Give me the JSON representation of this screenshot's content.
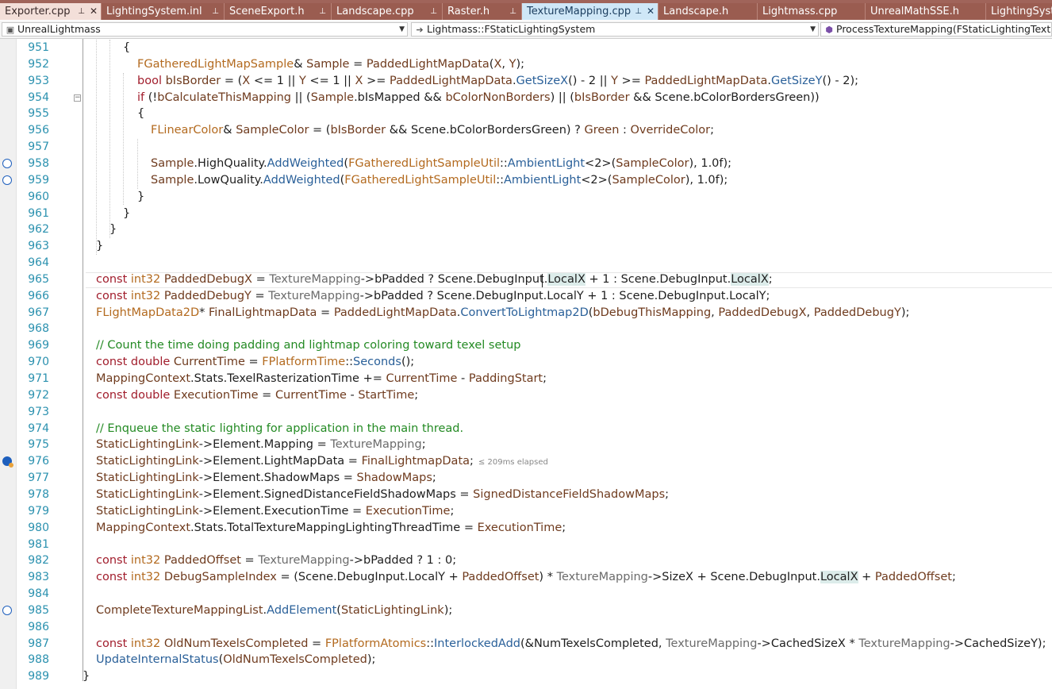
{
  "tabs": [
    {
      "label": "Exporter.cpp",
      "state": "first",
      "pin": "⊥",
      "close": "✕"
    },
    {
      "label": "LightingSystem.inl",
      "state": "normal",
      "pin": "⊥"
    },
    {
      "label": "SceneExport.h",
      "state": "normal",
      "pin": "⊥"
    },
    {
      "label": "Landscape.cpp",
      "state": "normal",
      "pin": "⊥"
    },
    {
      "label": "Raster.h",
      "state": "normal",
      "pin": "⊥"
    },
    {
      "label": "TextureMapping.cpp",
      "state": "active",
      "pin": "⊥",
      "close": "✕"
    },
    {
      "label": "Landscape.h",
      "state": "normal"
    },
    {
      "label": "Lightmass.cpp",
      "state": "normal"
    },
    {
      "label": "UnrealMathSSE.h",
      "state": "normal"
    },
    {
      "label": "LightingSyste",
      "state": "normal"
    }
  ],
  "navbar": {
    "project": "UnrealLightmass",
    "scope": "Lightmass::FStaticLightingSystem",
    "member": "ProcessTextureMapping(FStaticLightingTexture"
  },
  "editor": {
    "inline_hint": "≤ 209ms elapsed",
    "lines": [
      {
        "n": "951",
        "indent": 155,
        "tokens": [
          [
            "{",
            ""
          ]
        ]
      },
      {
        "n": "952",
        "indent": 173,
        "tokens": [
          [
            "FGatheredLightMapSample",
            "t"
          ],
          [
            "& ",
            ""
          ],
          [
            "Sample",
            "vm"
          ],
          [
            " = ",
            ""
          ],
          [
            "PaddedLightMapData",
            "vm"
          ],
          [
            "(",
            ""
          ],
          [
            "X",
            "vm"
          ],
          [
            ", ",
            ""
          ],
          [
            "Y",
            "vm"
          ],
          [
            ");",
            ""
          ]
        ]
      },
      {
        "n": "953",
        "indent": 173,
        "tokens": [
          [
            "bool ",
            "kw"
          ],
          [
            "bIsBorder",
            "vm"
          ],
          [
            " = (",
            ""
          ],
          [
            "X",
            "vm"
          ],
          [
            " <= 1 || ",
            ""
          ],
          [
            "Y",
            "vm"
          ],
          [
            " <= 1 || ",
            ""
          ],
          [
            "X",
            "vm"
          ],
          [
            " >= ",
            ""
          ],
          [
            "PaddedLightMapData",
            "vm"
          ],
          [
            ".",
            ""
          ],
          [
            "GetSizeX",
            "fn"
          ],
          [
            "() - 2 || ",
            ""
          ],
          [
            "Y",
            "vm"
          ],
          [
            " >= ",
            ""
          ],
          [
            "PaddedLightMapData",
            "vm"
          ],
          [
            ".",
            ""
          ],
          [
            "GetSizeY",
            "fn"
          ],
          [
            "() - 2);",
            ""
          ]
        ]
      },
      {
        "n": "954",
        "indent": 173,
        "tokens": [
          [
            "if",
            "kw"
          ],
          [
            " (!",
            ""
          ],
          [
            "bCalculateThisMapping",
            "vm"
          ],
          [
            " || (",
            ""
          ],
          [
            "Sample",
            "vm"
          ],
          [
            ".bIsMapped && ",
            ""
          ],
          [
            "bColorNonBorders",
            "vm"
          ],
          [
            ") || (",
            ""
          ],
          [
            "bIsBorder",
            "vm"
          ],
          [
            " && Scene.bColorBordersGreen))",
            ""
          ]
        ]
      },
      {
        "n": "955",
        "indent": 173,
        "tokens": [
          [
            "{",
            ""
          ]
        ]
      },
      {
        "n": "956",
        "indent": 190,
        "tokens": [
          [
            "FLinearColor",
            "t"
          ],
          [
            "& ",
            ""
          ],
          [
            "SampleColor",
            "vm"
          ],
          [
            " = (",
            ""
          ],
          [
            "bIsBorder",
            "vm"
          ],
          [
            " && Scene.bColorBordersGreen) ? ",
            ""
          ],
          [
            "Green",
            "vm"
          ],
          [
            " : ",
            ""
          ],
          [
            "OverrideColor",
            "vm"
          ],
          [
            ";",
            ""
          ]
        ]
      },
      {
        "n": "957",
        "indent": 190,
        "tokens": []
      },
      {
        "n": "958",
        "indent": 190,
        "tokens": [
          [
            "Sample",
            "vm"
          ],
          [
            ".HighQuality.",
            ""
          ],
          [
            "AddWeighted",
            "fn"
          ],
          [
            "(",
            ""
          ],
          [
            "FGatheredLightSampleUtil",
            "t"
          ],
          [
            "::",
            ""
          ],
          [
            "AmbientLight",
            "fn"
          ],
          [
            "<2>(",
            ""
          ],
          [
            "SampleColor",
            "vm"
          ],
          [
            "), 1.0f);",
            ""
          ]
        ]
      },
      {
        "n": "959",
        "indent": 190,
        "tokens": [
          [
            "Sample",
            "vm"
          ],
          [
            ".LowQuality.",
            ""
          ],
          [
            "AddWeighted",
            "fn"
          ],
          [
            "(",
            ""
          ],
          [
            "FGatheredLightSampleUtil",
            "t"
          ],
          [
            "::",
            ""
          ],
          [
            "AmbientLight",
            "fn"
          ],
          [
            "<2>(",
            ""
          ],
          [
            "SampleColor",
            "vm"
          ],
          [
            "), 1.0f);",
            ""
          ]
        ]
      },
      {
        "n": "960",
        "indent": 173,
        "tokens": [
          [
            "}",
            ""
          ]
        ]
      },
      {
        "n": "961",
        "indent": 155,
        "tokens": [
          [
            "}",
            ""
          ]
        ]
      },
      {
        "n": "962",
        "indent": 138,
        "tokens": [
          [
            "}",
            ""
          ]
        ]
      },
      {
        "n": "963",
        "indent": 121,
        "tokens": [
          [
            "}",
            ""
          ]
        ]
      },
      {
        "n": "964",
        "indent": 121,
        "tokens": []
      },
      {
        "n": "965",
        "indent": 121,
        "tokens": [
          [
            "const ",
            "kw"
          ],
          [
            "int32 ",
            "t"
          ],
          [
            "PaddedDebugX",
            "vm"
          ],
          [
            " = ",
            ""
          ],
          [
            "TextureMapping",
            "pr"
          ],
          [
            "->bPadded ? Scene.DebugInput.",
            ""
          ],
          [
            "LocalX",
            "hl"
          ],
          [
            " + 1 : Scene.DebugInput.",
            ""
          ],
          [
            "LocalX",
            "hl"
          ],
          [
            ";",
            ""
          ]
        ]
      },
      {
        "n": "966",
        "indent": 121,
        "tokens": [
          [
            "const ",
            "kw"
          ],
          [
            "int32 ",
            "t"
          ],
          [
            "PaddedDebugY",
            "vm"
          ],
          [
            " = ",
            ""
          ],
          [
            "TextureMapping",
            "pr"
          ],
          [
            "->bPadded ? Scene.DebugInput.LocalY + 1 : Scene.DebugInput.LocalY;",
            ""
          ]
        ]
      },
      {
        "n": "967",
        "indent": 121,
        "tokens": [
          [
            "FLightMapData2D",
            "t"
          ],
          [
            "* ",
            ""
          ],
          [
            "FinalLightmapData",
            "vm"
          ],
          [
            " = ",
            ""
          ],
          [
            "PaddedLightMapData",
            "vm"
          ],
          [
            ".",
            ""
          ],
          [
            "ConvertToLightmap2D",
            "fn"
          ],
          [
            "(",
            ""
          ],
          [
            "bDebugThisMapping",
            "vm"
          ],
          [
            ", ",
            ""
          ],
          [
            "PaddedDebugX",
            "vm"
          ],
          [
            ", ",
            ""
          ],
          [
            "PaddedDebugY",
            "vm"
          ],
          [
            ");",
            ""
          ]
        ]
      },
      {
        "n": "968",
        "indent": 121,
        "tokens": []
      },
      {
        "n": "969",
        "indent": 121,
        "tokens": [
          [
            "// Count the time doing padding and lightmap coloring toward texel setup",
            "cm"
          ]
        ]
      },
      {
        "n": "970",
        "indent": 121,
        "tokens": [
          [
            "const ",
            "kw"
          ],
          [
            "double ",
            "kw"
          ],
          [
            "CurrentTime",
            "vm"
          ],
          [
            " = ",
            ""
          ],
          [
            "FPlatformTime",
            "t"
          ],
          [
            "::",
            ""
          ],
          [
            "Seconds",
            "fn"
          ],
          [
            "();",
            ""
          ]
        ]
      },
      {
        "n": "971",
        "indent": 121,
        "tokens": [
          [
            "MappingContext",
            "vm"
          ],
          [
            ".Stats.TexelRasterizationTime += ",
            ""
          ],
          [
            "CurrentTime",
            "vm"
          ],
          [
            " - ",
            ""
          ],
          [
            "PaddingStart",
            "vm"
          ],
          [
            ";",
            ""
          ]
        ]
      },
      {
        "n": "972",
        "indent": 121,
        "tokens": [
          [
            "const ",
            "kw"
          ],
          [
            "double ",
            "kw"
          ],
          [
            "ExecutionTime",
            "vm"
          ],
          [
            " = ",
            ""
          ],
          [
            "CurrentTime",
            "vm"
          ],
          [
            " - ",
            ""
          ],
          [
            "StartTime",
            "vm"
          ],
          [
            ";",
            ""
          ]
        ]
      },
      {
        "n": "973",
        "indent": 121,
        "tokens": []
      },
      {
        "n": "974",
        "indent": 121,
        "tokens": [
          [
            "// Enqueue the static lighting for application in the main thread.",
            "cm"
          ]
        ]
      },
      {
        "n": "975",
        "indent": 121,
        "tokens": [
          [
            "StaticLightingLink",
            "vm"
          ],
          [
            "->Element.Mapping = ",
            ""
          ],
          [
            "TextureMapping",
            "pr"
          ],
          [
            ";",
            ""
          ]
        ]
      },
      {
        "n": "976",
        "indent": 121,
        "tokens": [
          [
            "StaticLightingLink",
            "vm"
          ],
          [
            "->Element.LightMapData = ",
            ""
          ],
          [
            "FinalLightmapData",
            "vm"
          ],
          [
            ";",
            ""
          ]
        ],
        "hint": true
      },
      {
        "n": "977",
        "indent": 121,
        "tokens": [
          [
            "StaticLightingLink",
            "vm"
          ],
          [
            "->Element.ShadowMaps = ",
            ""
          ],
          [
            "ShadowMaps",
            "vm"
          ],
          [
            ";",
            ""
          ]
        ]
      },
      {
        "n": "978",
        "indent": 121,
        "tokens": [
          [
            "StaticLightingLink",
            "vm"
          ],
          [
            "->Element.SignedDistanceFieldShadowMaps = ",
            ""
          ],
          [
            "SignedDistanceFieldShadowMaps",
            "vm"
          ],
          [
            ";",
            ""
          ]
        ]
      },
      {
        "n": "979",
        "indent": 121,
        "tokens": [
          [
            "StaticLightingLink",
            "vm"
          ],
          [
            "->Element.ExecutionTime = ",
            ""
          ],
          [
            "ExecutionTime",
            "vm"
          ],
          [
            ";",
            ""
          ]
        ]
      },
      {
        "n": "980",
        "indent": 121,
        "tokens": [
          [
            "MappingContext",
            "vm"
          ],
          [
            ".Stats.TotalTextureMappingLightingThreadTime = ",
            ""
          ],
          [
            "ExecutionTime",
            "vm"
          ],
          [
            ";",
            ""
          ]
        ]
      },
      {
        "n": "981",
        "indent": 121,
        "tokens": []
      },
      {
        "n": "982",
        "indent": 121,
        "tokens": [
          [
            "const ",
            "kw"
          ],
          [
            "int32 ",
            "t"
          ],
          [
            "PaddedOffset",
            "vm"
          ],
          [
            " = ",
            ""
          ],
          [
            "TextureMapping",
            "pr"
          ],
          [
            "->bPadded ? 1 : 0;",
            ""
          ]
        ]
      },
      {
        "n": "983",
        "indent": 121,
        "tokens": [
          [
            "const ",
            "kw"
          ],
          [
            "int32 ",
            "t"
          ],
          [
            "DebugSampleIndex",
            "vm"
          ],
          [
            " = (Scene.DebugInput.LocalY + ",
            ""
          ],
          [
            "PaddedOffset",
            "vm"
          ],
          [
            ") * ",
            ""
          ],
          [
            "TextureMapping",
            "pr"
          ],
          [
            "->SizeX + Scene.DebugInput.",
            ""
          ],
          [
            "LocalX",
            "hl"
          ],
          [
            " + ",
            ""
          ],
          [
            "PaddedOffset",
            "vm"
          ],
          [
            ";",
            ""
          ]
        ]
      },
      {
        "n": "984",
        "indent": 121,
        "tokens": []
      },
      {
        "n": "985",
        "indent": 121,
        "tokens": [
          [
            "CompleteTextureMappingList",
            "vm"
          ],
          [
            ".",
            ""
          ],
          [
            "AddElement",
            "fn"
          ],
          [
            "(",
            ""
          ],
          [
            "StaticLightingLink",
            "vm"
          ],
          [
            ");",
            ""
          ]
        ]
      },
      {
        "n": "986",
        "indent": 121,
        "tokens": []
      },
      {
        "n": "987",
        "indent": 121,
        "tokens": [
          [
            "const ",
            "kw"
          ],
          [
            "int32 ",
            "t"
          ],
          [
            "OldNumTexelsCompleted",
            "vm"
          ],
          [
            " = ",
            ""
          ],
          [
            "FPlatformAtomics",
            "t"
          ],
          [
            "::",
            ""
          ],
          [
            "InterlockedAdd",
            "fn"
          ],
          [
            "(&NumTexelsCompleted, ",
            ""
          ],
          [
            "TextureMapping",
            "pr"
          ],
          [
            "->CachedSizeX * ",
            ""
          ],
          [
            "TextureMapping",
            "pr"
          ],
          [
            "->CachedSizeY);",
            ""
          ]
        ]
      },
      {
        "n": "988",
        "indent": 121,
        "tokens": [
          [
            "UpdateInternalStatus",
            "fn"
          ],
          [
            "(",
            ""
          ],
          [
            "OldNumTexelsCompleted",
            "vm"
          ],
          [
            ");",
            ""
          ]
        ]
      },
      {
        "n": "989",
        "indent": 104,
        "tokens": [
          [
            "}",
            ""
          ]
        ]
      }
    ],
    "breakpoint_lines": [
      "958",
      "959",
      "985"
    ],
    "current_breakpoint_line": "976"
  }
}
